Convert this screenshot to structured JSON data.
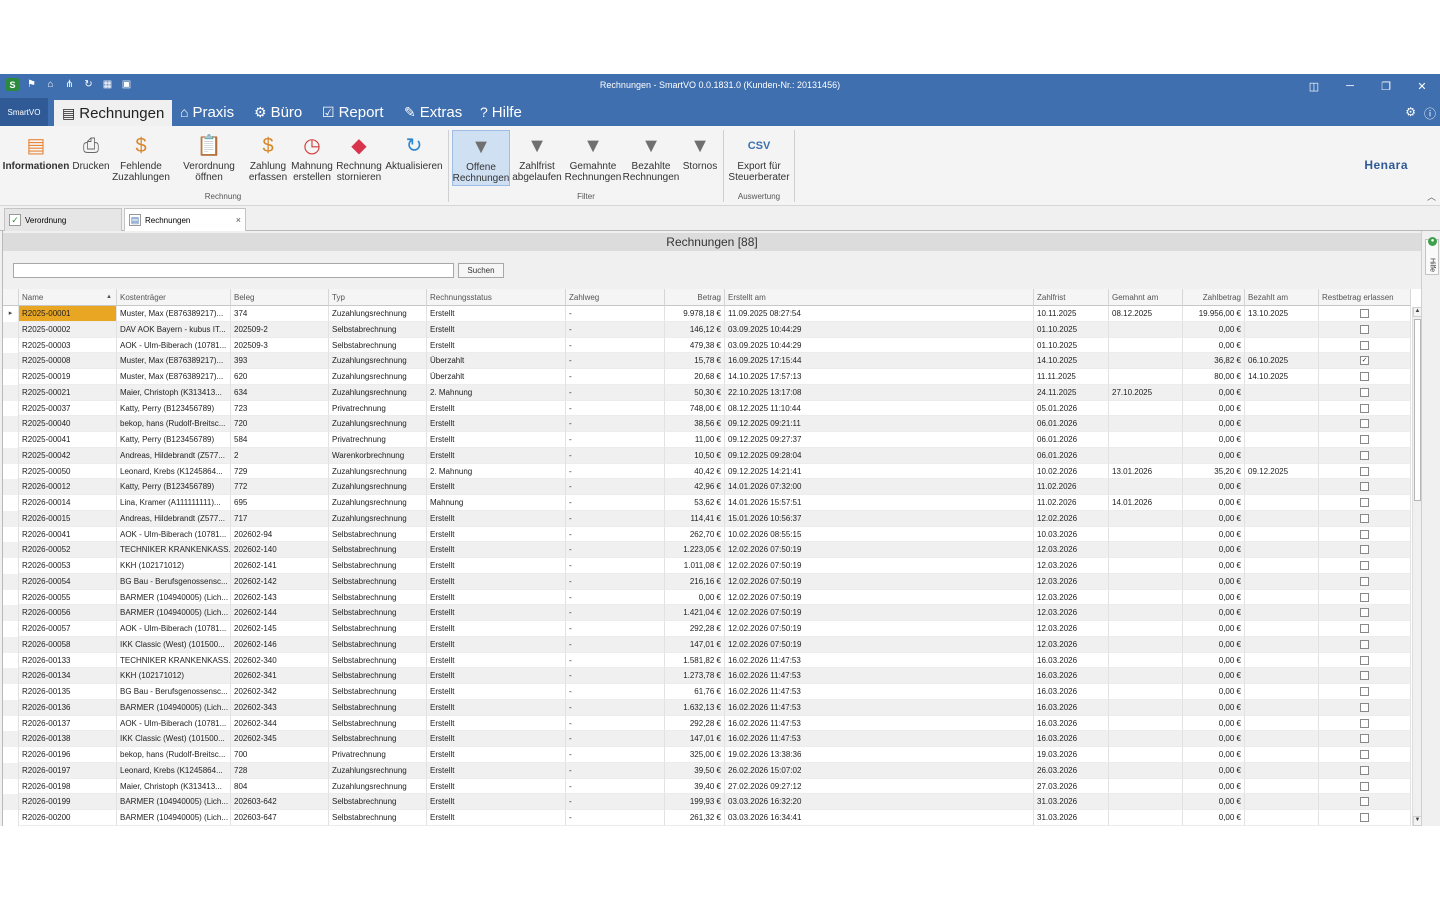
{
  "window": {
    "title": "Rechnungen - SmartVO 0.0.1831.0 (Kunden-Nr.: 20131456)",
    "quick_access_icons": [
      "app-icon",
      "flag-icon",
      "home-icon",
      "network-icon",
      "refresh-icon",
      "calendar-icon",
      "save-icon"
    ],
    "controls": [
      "layout-icon",
      "minimize-icon",
      "restore-icon",
      "close-icon"
    ]
  },
  "menu": {
    "app_button": "SmartVO",
    "items": [
      {
        "label": "Rechnungen",
        "icon": "invoice-icon",
        "active": true
      },
      {
        "label": "Praxis",
        "icon": "house-icon",
        "active": false
      },
      {
        "label": "Büro",
        "icon": "gears-icon",
        "active": false
      },
      {
        "label": "Report",
        "icon": "report-icon",
        "active": false
      },
      {
        "label": "Extras",
        "icon": "extras-icon",
        "active": false
      },
      {
        "label": "Hilfe",
        "icon": "help-icon",
        "active": false
      }
    ]
  },
  "ribbon": {
    "buttons": [
      {
        "label": "Informationen",
        "icon": "info-icon"
      },
      {
        "label": "Drucken",
        "icon": "printer-icon"
      },
      {
        "label": "Fehlende\nZuzahlungen",
        "icon": "coins-icon"
      },
      {
        "label": "Verordnung\nöffnen",
        "icon": "clipboard-icon"
      },
      {
        "label": "Zahlung\nerfassen",
        "icon": "payment-icon"
      },
      {
        "label": "Mahnung\nerstellen",
        "icon": "clock-icon"
      },
      {
        "label": "Rechnung\nstornieren",
        "icon": "eraser-icon"
      },
      {
        "label": "Aktualisieren",
        "icon": "refresh-icon"
      },
      {
        "label": "Offene\nRechnungen",
        "icon": "filter-icon"
      },
      {
        "label": "Zahlfrist\nabgelaufen",
        "icon": "filter-icon"
      },
      {
        "label": "Gemahnte\nRechnungen",
        "icon": "filter-icon"
      },
      {
        "label": "Bezahlte\nRechnungen",
        "icon": "filter-icon"
      },
      {
        "label": "Stornos",
        "icon": "filter-icon"
      },
      {
        "label": "Export für\nSteuerberater",
        "icon": "csv-icon"
      }
    ],
    "groups": {
      "rechnung": "Rechnung",
      "filter": "Filter",
      "auswertung": "Auswertung"
    },
    "logo": "Henara"
  },
  "doc_tabs": [
    {
      "label": "Verordnung",
      "active": false
    },
    {
      "label": "Rechnungen",
      "active": true
    }
  ],
  "main": {
    "heading": "Rechnungen [88]",
    "search_placeholder": "",
    "search_button": "Suchen",
    "side_help": "Hilfe"
  },
  "table": {
    "columns": [
      "Name",
      "Kostenträger",
      "Beleg",
      "Typ",
      "Rechnungsstatus",
      "Zahlweg",
      "Betrag",
      "Erstellt am",
      "Zahlfrist",
      "Gemahnt am",
      "Zahlbetrag",
      "Bezahlt am",
      "Restbetrag erlassen"
    ],
    "rows": [
      [
        "R2025-00001",
        "Muster, Max (E876389217)...",
        "374",
        "Zuzahlungsrechnung",
        "Erstellt",
        "-",
        "9.978,18 €",
        "11.09.2025 08:27:54",
        "10.11.2025",
        "08.12.2025",
        "19.956,00 €",
        "13.10.2025",
        false
      ],
      [
        "R2025-00002",
        "DAV AOK Bayern - kubus IT...",
        "202509-2",
        "Selbstabrechnung",
        "Erstellt",
        "-",
        "146,12 €",
        "03.09.2025 10:44:29",
        "01.10.2025",
        "",
        "0,00 €",
        "",
        false
      ],
      [
        "R2025-00003",
        "AOK - Ulm-Biberach (10781...",
        "202509-3",
        "Selbstabrechnung",
        "Erstellt",
        "-",
        "479,38 €",
        "03.09.2025 10:44:29",
        "01.10.2025",
        "",
        "0,00 €",
        "",
        false
      ],
      [
        "R2025-00008",
        "Muster, Max (E876389217)...",
        "393",
        "Zuzahlungsrechnung",
        "Überzahlt",
        "-",
        "15,78 €",
        "16.09.2025 17:15:44",
        "14.10.2025",
        "",
        "36,82 €",
        "06.10.2025",
        true
      ],
      [
        "R2025-00019",
        "Muster, Max (E876389217)...",
        "620",
        "Zuzahlungsrechnung",
        "Überzahlt",
        "-",
        "20,68 €",
        "14.10.2025 17:57:13",
        "11.11.2025",
        "",
        "80,00 €",
        "14.10.2025",
        false
      ],
      [
        "R2025-00021",
        "Maier, Christoph (K313413...",
        "634",
        "Zuzahlungsrechnung",
        "2. Mahnung",
        "-",
        "50,30 €",
        "22.10.2025 13:17:08",
        "24.11.2025",
        "27.10.2025",
        "0,00 €",
        "",
        false
      ],
      [
        "R2025-00037",
        "Katty, Perry (B123456789)",
        "723",
        "Privatrechnung",
        "Erstellt",
        "-",
        "748,00 €",
        "08.12.2025 11:10:44",
        "05.01.2026",
        "",
        "0,00 €",
        "",
        false
      ],
      [
        "R2025-00040",
        "bekop, hans (Rudolf-Breitsc...",
        "720",
        "Zuzahlungsrechnung",
        "Erstellt",
        "-",
        "38,56 €",
        "09.12.2025 09:21:11",
        "06.01.2026",
        "",
        "0,00 €",
        "",
        false
      ],
      [
        "R2025-00041",
        "Katty, Perry (B123456789)",
        "584",
        "Privatrechnung",
        "Erstellt",
        "-",
        "11,00 €",
        "09.12.2025 09:27:37",
        "06.01.2026",
        "",
        "0,00 €",
        "",
        false
      ],
      [
        "R2025-00042",
        "Andreas, Hildebrandt (Z577...",
        "2",
        "Warenkorbrechnung",
        "Erstellt",
        "-",
        "10,50 €",
        "09.12.2025 09:28:04",
        "06.01.2026",
        "",
        "0,00 €",
        "",
        false
      ],
      [
        "R2025-00050",
        "Leonard, Krebs (K1245864...",
        "729",
        "Zuzahlungsrechnung",
        "2. Mahnung",
        "-",
        "40,42 €",
        "09.12.2025 14:21:41",
        "10.02.2026",
        "13.01.2026",
        "35,20 €",
        "09.12.2025",
        false
      ],
      [
        "R2026-00012",
        "Katty, Perry (B123456789)",
        "772",
        "Zuzahlungsrechnung",
        "Erstellt",
        "-",
        "42,96 €",
        "14.01.2026 07:32:00",
        "11.02.2026",
        "",
        "0,00 €",
        "",
        false
      ],
      [
        "R2026-00014",
        "Lina, Kramer (A111111111)...",
        "695",
        "Zuzahlungsrechnung",
        "Mahnung",
        "-",
        "53,62 €",
        "14.01.2026 15:57:51",
        "11.02.2026",
        "14.01.2026",
        "0,00 €",
        "",
        false
      ],
      [
        "R2026-00015",
        "Andreas, Hildebrandt (Z577...",
        "717",
        "Zuzahlungsrechnung",
        "Erstellt",
        "-",
        "114,41 €",
        "15.01.2026 10:56:37",
        "12.02.2026",
        "",
        "0,00 €",
        "",
        false
      ],
      [
        "R2026-00041",
        "AOK - Ulm-Biberach (10781...",
        "202602-94",
        "Selbstabrechnung",
        "Erstellt",
        "-",
        "262,70 €",
        "10.02.2026 08:55:15",
        "10.03.2026",
        "",
        "0,00 €",
        "",
        false
      ],
      [
        "R2026-00052",
        "TECHNIKER KRANKENKASS...",
        "202602-140",
        "Selbstabrechnung",
        "Erstellt",
        "-",
        "1.223,05 €",
        "12.02.2026 07:50:19",
        "12.03.2026",
        "",
        "0,00 €",
        "",
        false
      ],
      [
        "R2026-00053",
        "KKH (102171012)",
        "202602-141",
        "Selbstabrechnung",
        "Erstellt",
        "-",
        "1.011,08 €",
        "12.02.2026 07:50:19",
        "12.03.2026",
        "",
        "0,00 €",
        "",
        false
      ],
      [
        "R2026-00054",
        "BG Bau - Berufsgenossensc...",
        "202602-142",
        "Selbstabrechnung",
        "Erstellt",
        "-",
        "216,16 €",
        "12.02.2026 07:50:19",
        "12.03.2026",
        "",
        "0,00 €",
        "",
        false
      ],
      [
        "R2026-00055",
        "BARMER (104940005) (Lich...",
        "202602-143",
        "Selbstabrechnung",
        "Erstellt",
        "-",
        "0,00 €",
        "12.02.2026 07:50:19",
        "12.03.2026",
        "",
        "0,00 €",
        "",
        false
      ],
      [
        "R2026-00056",
        "BARMER (104940005) (Lich...",
        "202602-144",
        "Selbstabrechnung",
        "Erstellt",
        "-",
        "1.421,04 €",
        "12.02.2026 07:50:19",
        "12.03.2026",
        "",
        "0,00 €",
        "",
        false
      ],
      [
        "R2026-00057",
        "AOK - Ulm-Biberach (10781...",
        "202602-145",
        "Selbstabrechnung",
        "Erstellt",
        "-",
        "292,28 €",
        "12.02.2026 07:50:19",
        "12.03.2026",
        "",
        "0,00 €",
        "",
        false
      ],
      [
        "R2026-00058",
        "IKK Classic (West) (101500...",
        "202602-146",
        "Selbstabrechnung",
        "Erstellt",
        "-",
        "147,01 €",
        "12.02.2026 07:50:19",
        "12.03.2026",
        "",
        "0,00 €",
        "",
        false
      ],
      [
        "R2026-00133",
        "TECHNIKER KRANKENKASS...",
        "202602-340",
        "Selbstabrechnung",
        "Erstellt",
        "-",
        "1.581,82 €",
        "16.02.2026 11:47:53",
        "16.03.2026",
        "",
        "0,00 €",
        "",
        false
      ],
      [
        "R2026-00134",
        "KKH (102171012)",
        "202602-341",
        "Selbstabrechnung",
        "Erstellt",
        "-",
        "1.273,78 €",
        "16.02.2026 11:47:53",
        "16.03.2026",
        "",
        "0,00 €",
        "",
        false
      ],
      [
        "R2026-00135",
        "BG Bau - Berufsgenossensc...",
        "202602-342",
        "Selbstabrechnung",
        "Erstellt",
        "-",
        "61,76 €",
        "16.02.2026 11:47:53",
        "16.03.2026",
        "",
        "0,00 €",
        "",
        false
      ],
      [
        "R2026-00136",
        "BARMER (104940005) (Lich...",
        "202602-343",
        "Selbstabrechnung",
        "Erstellt",
        "-",
        "1.632,13 €",
        "16.02.2026 11:47:53",
        "16.03.2026",
        "",
        "0,00 €",
        "",
        false
      ],
      [
        "R2026-00137",
        "AOK - Ulm-Biberach (10781...",
        "202602-344",
        "Selbstabrechnung",
        "Erstellt",
        "-",
        "292,28 €",
        "16.02.2026 11:47:53",
        "16.03.2026",
        "",
        "0,00 €",
        "",
        false
      ],
      [
        "R2026-00138",
        "IKK Classic (West) (101500...",
        "202602-345",
        "Selbstabrechnung",
        "Erstellt",
        "-",
        "147,01 €",
        "16.02.2026 11:47:53",
        "16.03.2026",
        "",
        "0,00 €",
        "",
        false
      ],
      [
        "R2026-00196",
        "bekop, hans (Rudolf-Breitsc...",
        "700",
        "Privatrechnung",
        "Erstellt",
        "-",
        "325,00 €",
        "19.02.2026 13:38:36",
        "19.03.2026",
        "",
        "0,00 €",
        "",
        false
      ],
      [
        "R2026-00197",
        "Leonard, Krebs (K1245864...",
        "728",
        "Zuzahlungsrechnung",
        "Erstellt",
        "-",
        "39,50 €",
        "26.02.2026 15:07:02",
        "26.03.2026",
        "",
        "0,00 €",
        "",
        false
      ],
      [
        "R2026-00198",
        "Maier, Christoph (K313413...",
        "804",
        "Zuzahlungsrechnung",
        "Erstellt",
        "-",
        "39,40 €",
        "27.02.2026 09:27:12",
        "27.03.2026",
        "",
        "0,00 €",
        "",
        false
      ],
      [
        "R2026-00199",
        "BARMER (104940005) (Lich...",
        "202603-642",
        "Selbstabrechnung",
        "Erstellt",
        "-",
        "199,93 €",
        "03.03.2026 16:32:20",
        "31.03.2026",
        "",
        "0,00 €",
        "",
        false
      ],
      [
        "R2026-00200",
        "BARMER (104940005) (Lich...",
        "202603-647",
        "Selbstabrechnung",
        "Erstellt",
        "-",
        "261,32 €",
        "03.03.2026 16:34:41",
        "31.03.2026",
        "",
        "0,00 €",
        "",
        false
      ]
    ]
  },
  "colors": {
    "titlebar": "#3f6fae",
    "selected_cell": "#e8a623",
    "ribbon_selected": "#cfe0f3"
  }
}
